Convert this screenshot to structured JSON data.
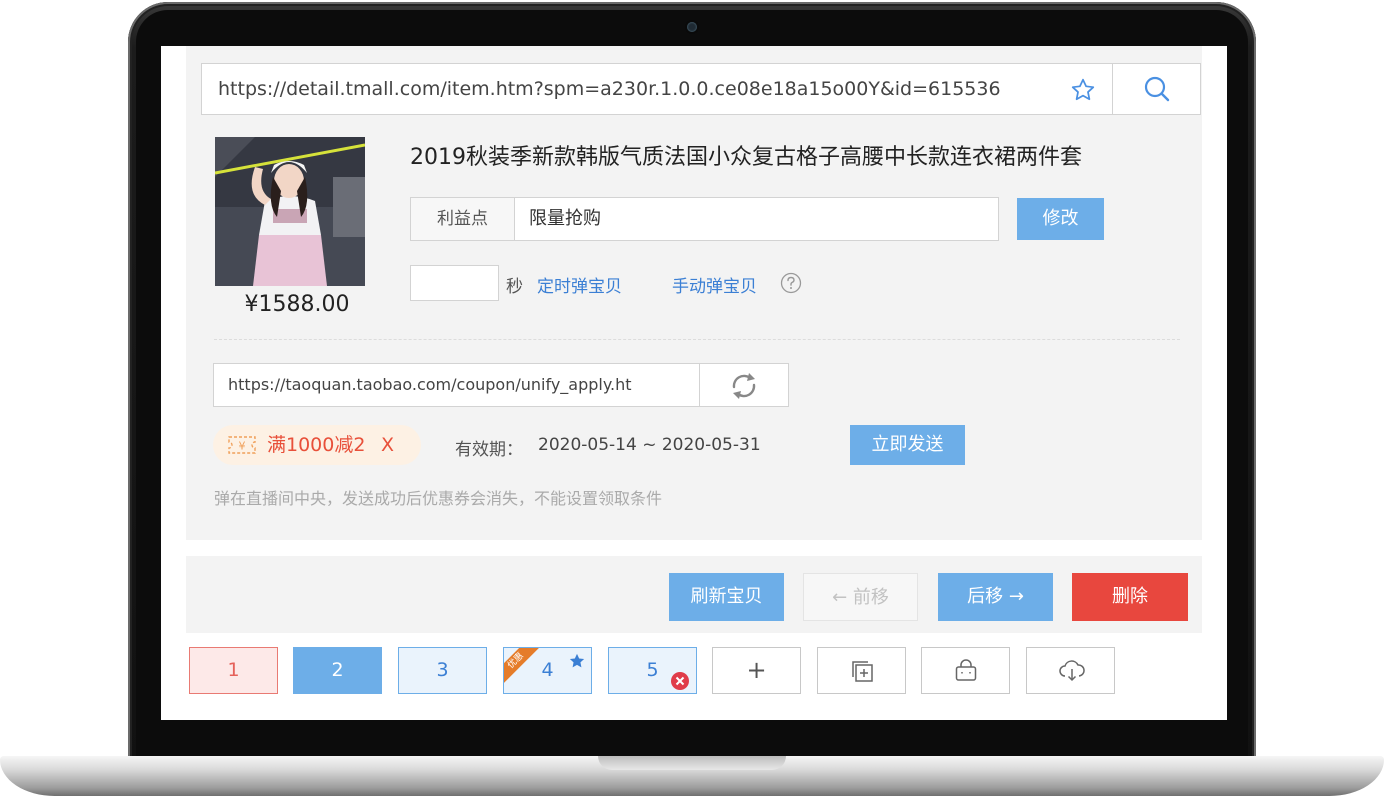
{
  "url_bar": {
    "value": "https://detail.tmall.com/item.htm?spm=a230r.1.0.0.ce08e18a15o00Y&id=615536"
  },
  "product": {
    "title": "2019秋装季新款韩版气质法国小众复古格子高腰中长款连衣裙两件套",
    "price": "¥1588.00",
    "benefit_label": "利益点",
    "benefit_value": "限量抢购",
    "edit_label": "修改",
    "seconds_value": "",
    "seconds_unit": "秒",
    "timed_link": "定时弹宝贝",
    "manual_link": "手动弹宝贝"
  },
  "coupon": {
    "url": "https://taoquan.taobao.com/coupon/unify_apply.ht",
    "ticket_symbol": "¥",
    "tag_text": "满1000减2",
    "remove_label": "X",
    "valid_label": "有效期：",
    "valid_range": "2020-05-14 ~ 2020-05-31",
    "send_label": "立即发送",
    "hint": "弹在直播间中央，发送成功后优惠券会消失，不能设置领取条件"
  },
  "actions": {
    "refresh_label": "刷新宝贝",
    "prev_label": "← 前移",
    "next_label": "后移 →",
    "delete_label": "删除"
  },
  "tabs": {
    "items": [
      "1",
      "2",
      "3",
      "4",
      "5"
    ],
    "ribbon_label": "优惠",
    "add_symbol": "+"
  },
  "colors": {
    "accent_blue": "#6daee8",
    "link_blue": "#3b7fd4",
    "danger_red": "#e8473e",
    "coupon_orange": "#e8503a"
  }
}
